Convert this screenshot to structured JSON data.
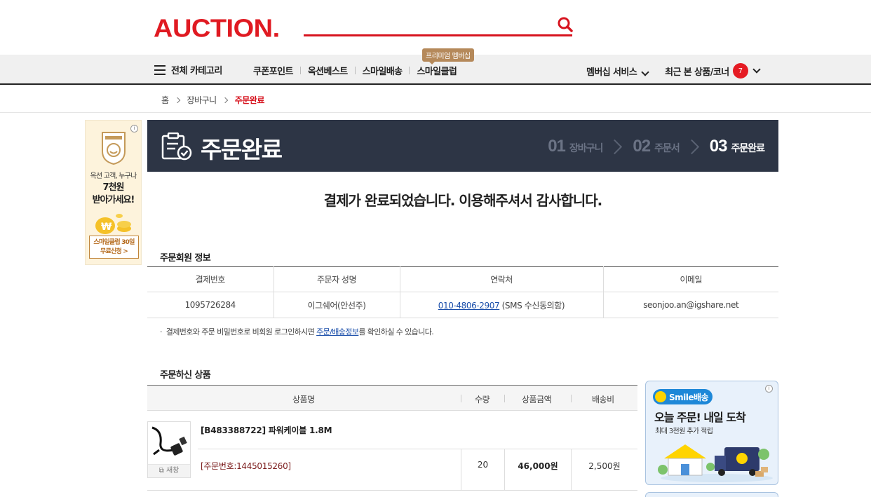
{
  "header": {
    "logo": "AUCTION.",
    "search_icon": "search-icon"
  },
  "gnb": {
    "all_categories": "전체 카테고리",
    "menu": [
      "쿠폰포인트",
      "옥션베스트",
      "스마일배송",
      "스마일클럽"
    ],
    "premium_tag": "프리미엄 멤버십",
    "membership": "멤버십 서비스",
    "recent": "최근 본 상품/코너",
    "recent_count": "7"
  },
  "breadcrumb": {
    "home": "홈",
    "cart": "장바구니",
    "current": "주문완료"
  },
  "left_ad": {
    "line1": "옥션 고객, 누구나",
    "line2": "7천원",
    "line3": "받아가세요!",
    "cta_line1": "스마일클럽 30일",
    "cta_line2": "무료신청 >"
  },
  "title_bar": {
    "title": "주문완료",
    "steps": [
      {
        "num": "01",
        "label": "장바구니"
      },
      {
        "num": "02",
        "label": "주문서"
      },
      {
        "num": "03",
        "label": "주문완료"
      }
    ]
  },
  "message": "결제가 완료되었습니다. 이용해주셔서 감사합니다.",
  "member_info": {
    "section_title": "주문회원 정보",
    "headers": [
      "결제번호",
      "주문자 성명",
      "연락처",
      "이메일"
    ],
    "payment_no": "1095726284",
    "name": "이그쉐어(안선주)",
    "phone": "010-4806-2907",
    "phone_suffix": " (SMS 수신동의함)",
    "email": "seonjoo.an@igshare.net"
  },
  "note": {
    "prefix": "결제번호와 주문 비밀번호로 비회원 로그인하시면 ",
    "link": "주문/배송정보",
    "suffix": "를 확인하실 수 있습니다."
  },
  "products": {
    "section_title": "주문하신 상품",
    "headers": [
      "상품명",
      "수량",
      "상품금액",
      "배송비"
    ],
    "new_window": "새창",
    "item": {
      "name": "[B483388722] 파워케이블 1.8M",
      "order_no": "[주문번호:1445015260]",
      "qty": "20",
      "price": "46,000원",
      "shipping": "2,500원"
    }
  },
  "right_ad": {
    "badge": "Smile배송",
    "headline": "오늘 주문! 내일 도착",
    "sub": "최대 3천원 추가 적립"
  },
  "colors": {
    "brand": "#e01a22",
    "title_bar": "#2d3545",
    "link": "#1a4eaa"
  }
}
